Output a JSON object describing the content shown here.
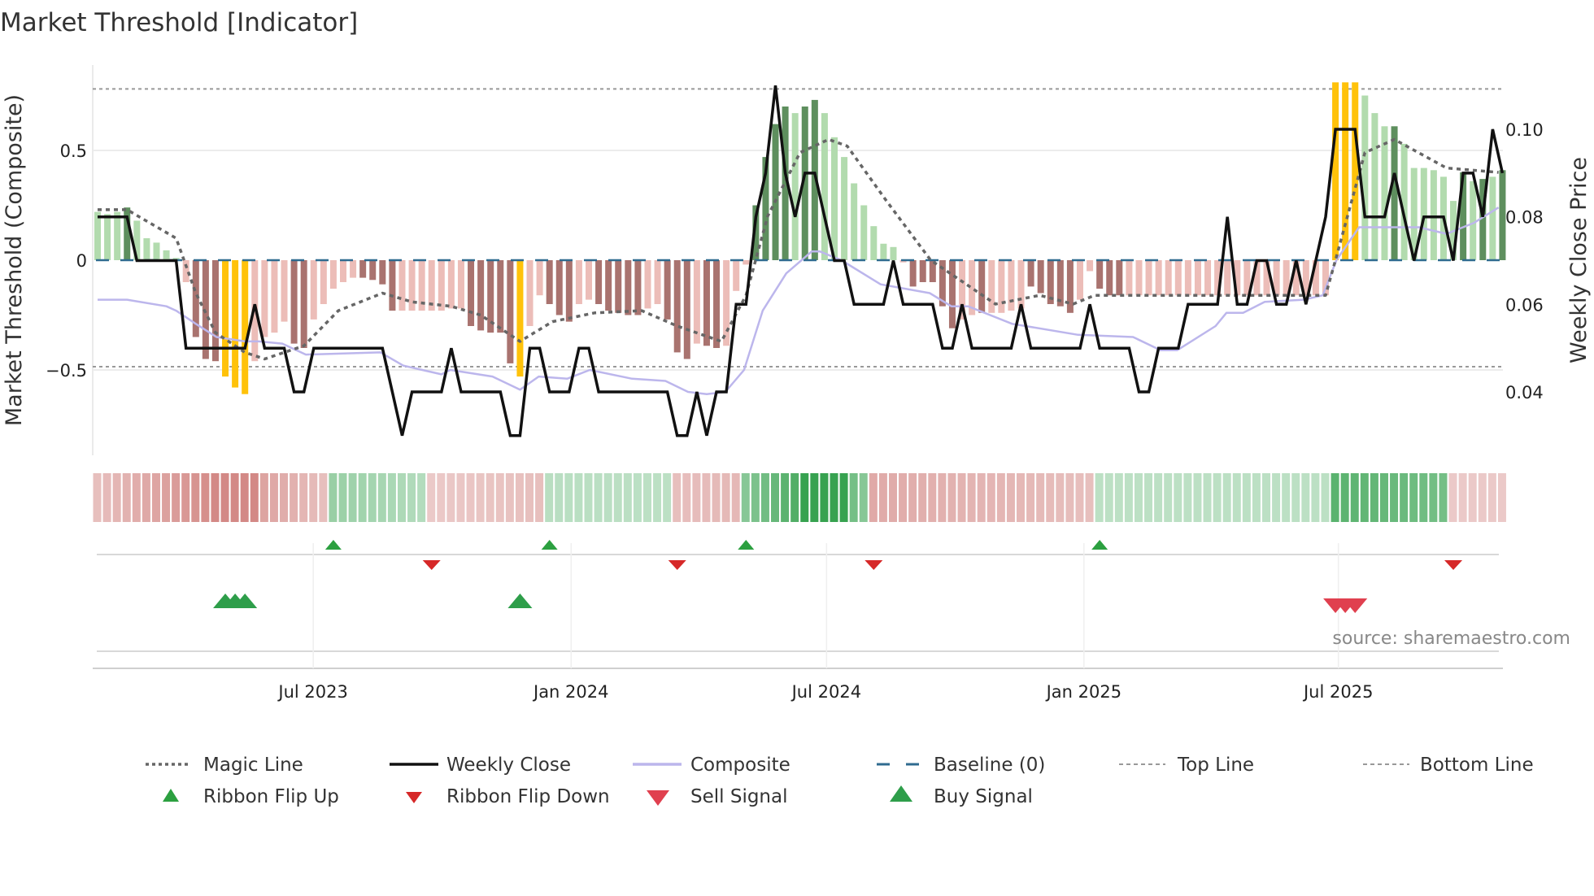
{
  "title": "Market Threshold [Indicator]",
  "source": "source: sharemaestro.com",
  "colors": {
    "bar_dark_green": "#5e8f5e",
    "bar_light_green": "#b2dbae",
    "bar_dark_red": "#a9736f",
    "bar_light_red": "#ecbdb8",
    "bar_yellow": "#ffc20a",
    "ribbon_green": "#2e9e48",
    "ribbon_red": "#c4605c",
    "magic": "#666666",
    "close": "#111111",
    "composite": "#bcb6ec",
    "baseline": "#2f6b8f",
    "guide": "#999999",
    "flip_up": "#2ca040",
    "flip_down": "#d62828",
    "buy": "#2e9e4a",
    "sell": "#e0404f"
  },
  "chart_data": {
    "type": "bar+line",
    "title": "Market Threshold [Indicator]",
    "ylabel": "Market Threshold (Composite)",
    "y2label": "Weekly Close Price",
    "ylim": [
      -0.9,
      0.9
    ],
    "y2lim": [
      0.025,
      0.115
    ],
    "yticks": [
      {
        "v": 0.5,
        "label": "0.5"
      },
      {
        "v": 0,
        "label": "0"
      },
      {
        "v": -0.5,
        "label": "−0.5"
      }
    ],
    "y2ticks": [
      {
        "v": 0.1,
        "label": "0.10"
      },
      {
        "v": 0.08,
        "label": "0.08"
      },
      {
        "v": 0.06,
        "label": "0.06"
      },
      {
        "v": 0.04,
        "label": "0.04"
      }
    ],
    "xticks": [
      {
        "week": 21.95,
        "label": "Jul 2023"
      },
      {
        "week": 48.2,
        "label": "Jan 2024"
      },
      {
        "week": 74.2,
        "label": "Jul 2024"
      },
      {
        "week": 100.4,
        "label": "Jan 2025"
      },
      {
        "week": 126.3,
        "label": "Jul 2025"
      }
    ],
    "top_line": 0.78,
    "bottom_line": -0.485,
    "baseline": 0,
    "bars": [
      [
        0.22,
        "g"
      ],
      [
        0.21,
        "g"
      ],
      [
        0.22,
        "g"
      ],
      [
        0.24,
        "G"
      ],
      [
        0.18,
        "g"
      ],
      [
        0.1,
        "g"
      ],
      [
        0.08,
        "g"
      ],
      [
        0.045,
        "g"
      ],
      [
        0.01,
        "g"
      ],
      [
        -0.1,
        "r"
      ],
      [
        -0.35,
        "R"
      ],
      [
        -0.45,
        "R"
      ],
      [
        -0.46,
        "R"
      ],
      [
        -0.53,
        "Y"
      ],
      [
        -0.58,
        "Y"
      ],
      [
        -0.61,
        "Y"
      ],
      [
        -0.46,
        "r"
      ],
      [
        -0.35,
        "r"
      ],
      [
        -0.33,
        "r"
      ],
      [
        -0.28,
        "r"
      ],
      [
        -0.38,
        "R"
      ],
      [
        -0.4,
        "R"
      ],
      [
        -0.27,
        "r"
      ],
      [
        -0.2,
        "r"
      ],
      [
        -0.13,
        "r"
      ],
      [
        -0.1,
        "r"
      ],
      [
        -0.08,
        "r"
      ],
      [
        -0.08,
        "R"
      ],
      [
        -0.09,
        "R"
      ],
      [
        -0.11,
        "R"
      ],
      [
        -0.23,
        "R"
      ],
      [
        -0.23,
        "r"
      ],
      [
        -0.23,
        "r"
      ],
      [
        -0.23,
        "r"
      ],
      [
        -0.23,
        "r"
      ],
      [
        -0.23,
        "r"
      ],
      [
        -0.22,
        "r"
      ],
      [
        -0.22,
        "r"
      ],
      [
        -0.3,
        "R"
      ],
      [
        -0.32,
        "R"
      ],
      [
        -0.33,
        "R"
      ],
      [
        -0.33,
        "R"
      ],
      [
        -0.47,
        "R"
      ],
      [
        -0.53,
        "Y"
      ],
      [
        -0.3,
        "r"
      ],
      [
        -0.16,
        "r"
      ],
      [
        -0.2,
        "R"
      ],
      [
        -0.25,
        "R"
      ],
      [
        -0.28,
        "R"
      ],
      [
        -0.2,
        "r"
      ],
      [
        -0.18,
        "r"
      ],
      [
        -0.2,
        "R"
      ],
      [
        -0.23,
        "R"
      ],
      [
        -0.24,
        "R"
      ],
      [
        -0.25,
        "R"
      ],
      [
        -0.25,
        "R"
      ],
      [
        -0.22,
        "r"
      ],
      [
        -0.2,
        "r"
      ],
      [
        -0.27,
        "R"
      ],
      [
        -0.42,
        "R"
      ],
      [
        -0.45,
        "R"
      ],
      [
        -0.38,
        "r"
      ],
      [
        -0.39,
        "R"
      ],
      [
        -0.4,
        "R"
      ],
      [
        -0.39,
        "r"
      ],
      [
        -0.14,
        "r"
      ],
      [
        -0.02,
        "r"
      ],
      [
        0.25,
        "G"
      ],
      [
        0.47,
        "G"
      ],
      [
        0.62,
        "G"
      ],
      [
        0.7,
        "G"
      ],
      [
        0.67,
        "g"
      ],
      [
        0.7,
        "G"
      ],
      [
        0.73,
        "G"
      ],
      [
        0.67,
        "g"
      ],
      [
        0.56,
        "g"
      ],
      [
        0.47,
        "g"
      ],
      [
        0.35,
        "g"
      ],
      [
        0.25,
        "g"
      ],
      [
        0.155,
        "g"
      ],
      [
        0.075,
        "g"
      ],
      [
        0.06,
        "g"
      ],
      [
        -0.01,
        "r"
      ],
      [
        -0.12,
        "R"
      ],
      [
        -0.1,
        "R"
      ],
      [
        -0.1,
        "R"
      ],
      [
        -0.21,
        "R"
      ],
      [
        -0.31,
        "R"
      ],
      [
        -0.27,
        "r"
      ],
      [
        -0.25,
        "r"
      ],
      [
        -0.24,
        "R"
      ],
      [
        -0.24,
        "r"
      ],
      [
        -0.24,
        "r"
      ],
      [
        -0.23,
        "r"
      ],
      [
        -0.22,
        "r"
      ],
      [
        -0.12,
        "R"
      ],
      [
        -0.15,
        "R"
      ],
      [
        -0.2,
        "R"
      ],
      [
        -0.21,
        "R"
      ],
      [
        -0.24,
        "R"
      ],
      [
        -0.18,
        "r"
      ],
      [
        -0.05,
        "r"
      ],
      [
        -0.13,
        "R"
      ],
      [
        -0.16,
        "R"
      ],
      [
        -0.16,
        "R"
      ],
      [
        -0.16,
        "r"
      ],
      [
        -0.16,
        "r"
      ],
      [
        -0.16,
        "r"
      ],
      [
        -0.16,
        "r"
      ],
      [
        -0.16,
        "r"
      ],
      [
        -0.16,
        "r"
      ],
      [
        -0.16,
        "r"
      ],
      [
        -0.16,
        "r"
      ],
      [
        -0.16,
        "r"
      ],
      [
        -0.16,
        "r"
      ],
      [
        -0.16,
        "r"
      ],
      [
        -0.16,
        "r"
      ],
      [
        -0.16,
        "r"
      ],
      [
        -0.16,
        "r"
      ],
      [
        -0.16,
        "r"
      ],
      [
        -0.16,
        "r"
      ],
      [
        -0.16,
        "r"
      ],
      [
        -0.16,
        "r"
      ],
      [
        -0.16,
        "r"
      ],
      [
        -0.16,
        "r"
      ],
      [
        -0.16,
        "r"
      ],
      [
        0.81,
        "Y"
      ],
      [
        0.81,
        "Y"
      ],
      [
        0.81,
        "Y"
      ],
      [
        0.75,
        "g"
      ],
      [
        0.67,
        "g"
      ],
      [
        0.61,
        "g"
      ],
      [
        0.61,
        "G"
      ],
      [
        0.53,
        "g"
      ],
      [
        0.42,
        "g"
      ],
      [
        0.42,
        "g"
      ],
      [
        0.41,
        "g"
      ],
      [
        0.38,
        "g"
      ],
      [
        0.27,
        "g"
      ],
      [
        0.4,
        "G"
      ],
      [
        0.36,
        "g"
      ],
      [
        0.37,
        "G"
      ],
      [
        0.38,
        "g"
      ],
      [
        0.41,
        "G"
      ]
    ],
    "weekly_close": [
      0.08,
      0.08,
      0.08,
      0.08,
      0.07,
      0.07,
      0.07,
      0.07,
      0.07,
      0.05,
      0.05,
      0.05,
      0.05,
      0.05,
      0.05,
      0.05,
      0.06,
      0.05,
      0.05,
      0.05,
      0.04,
      0.04,
      0.05,
      0.05,
      0.05,
      0.05,
      0.05,
      0.05,
      0.05,
      0.05,
      0.04,
      0.03,
      0.04,
      0.04,
      0.04,
      0.04,
      0.05,
      0.04,
      0.04,
      0.04,
      0.04,
      0.04,
      0.03,
      0.03,
      0.05,
      0.05,
      0.04,
      0.04,
      0.04,
      0.05,
      0.05,
      0.04,
      0.04,
      0.04,
      0.04,
      0.04,
      0.04,
      0.04,
      0.04,
      0.03,
      0.03,
      0.04,
      0.03,
      0.04,
      0.04,
      0.06,
      0.06,
      0.08,
      0.09,
      0.11,
      0.09,
      0.08,
      0.09,
      0.09,
      0.08,
      0.07,
      0.07,
      0.06,
      0.06,
      0.06,
      0.06,
      0.07,
      0.06,
      0.06,
      0.06,
      0.06,
      0.05,
      0.05,
      0.06,
      0.05,
      0.05,
      0.05,
      0.05,
      0.05,
      0.06,
      0.05,
      0.05,
      0.05,
      0.05,
      0.05,
      0.05,
      0.06,
      0.05,
      0.05,
      0.05,
      0.05,
      0.04,
      0.04,
      0.05,
      0.05,
      0.05,
      0.06,
      0.06,
      0.06,
      0.06,
      0.08,
      0.06,
      0.06,
      0.07,
      0.07,
      0.06,
      0.06,
      0.07,
      0.06,
      0.07,
      0.08,
      0.1,
      0.1,
      0.1,
      0.08,
      0.08,
      0.08,
      0.09,
      0.08,
      0.07,
      0.08,
      0.08,
      0.08,
      0.07,
      0.09,
      0.09,
      0.08,
      0.1,
      0.09
    ],
    "magic_line": [
      [
        0,
        0.23
      ],
      [
        3,
        0.23
      ],
      [
        8,
        0.1
      ],
      [
        10,
        -0.15
      ],
      [
        12,
        -0.33
      ],
      [
        15,
        -0.42
      ],
      [
        17,
        -0.45
      ],
      [
        21,
        -0.39
      ],
      [
        24.5,
        -0.23
      ],
      [
        29,
        -0.15
      ],
      [
        32,
        -0.19
      ],
      [
        36,
        -0.21
      ],
      [
        39,
        -0.25
      ],
      [
        43,
        -0.37
      ],
      [
        46.3,
        -0.28
      ],
      [
        50.6,
        -0.24
      ],
      [
        55.4,
        -0.23
      ],
      [
        59,
        -0.3
      ],
      [
        63.5,
        -0.37
      ],
      [
        66,
        -0.16
      ],
      [
        68.2,
        0.2
      ],
      [
        71.5,
        0.49
      ],
      [
        74.4,
        0.55
      ],
      [
        76.3,
        0.52
      ],
      [
        80.3,
        0.27
      ],
      [
        84.8,
        0
      ],
      [
        91.4,
        -0.2
      ],
      [
        95.9,
        -0.16
      ],
      [
        99.3,
        -0.2
      ],
      [
        101.5,
        -0.16
      ],
      [
        125,
        -0.16
      ],
      [
        126,
        0
      ],
      [
        129,
        0.49
      ],
      [
        132,
        0.55
      ],
      [
        137.3,
        0.42
      ],
      [
        142.6,
        0.4
      ]
    ],
    "composite": [
      [
        0,
        -0.18
      ],
      [
        3,
        -0.18
      ],
      [
        7,
        -0.21
      ],
      [
        8,
        -0.23
      ],
      [
        10,
        -0.29
      ],
      [
        12.1,
        -0.35
      ],
      [
        15,
        -0.37
      ],
      [
        16.4,
        -0.37
      ],
      [
        18.8,
        -0.38
      ],
      [
        21.2,
        -0.43
      ],
      [
        28.8,
        -0.42
      ],
      [
        31.1,
        -0.48
      ],
      [
        35,
        -0.52
      ],
      [
        35.9,
        -0.5
      ],
      [
        40.2,
        -0.53
      ],
      [
        43,
        -0.59
      ],
      [
        44.9,
        -0.53
      ],
      [
        47.8,
        -0.54
      ],
      [
        50.1,
        -0.5
      ],
      [
        54.4,
        -0.54
      ],
      [
        57.8,
        -0.55
      ],
      [
        60.1,
        -0.6
      ],
      [
        62,
        -0.61
      ],
      [
        63.9,
        -0.6
      ],
      [
        65.8,
        -0.5
      ],
      [
        67.7,
        -0.23
      ],
      [
        70.1,
        -0.06
      ],
      [
        72.7,
        0.04
      ],
      [
        73.5,
        0.04
      ],
      [
        75.7,
        0
      ],
      [
        79.7,
        -0.11
      ],
      [
        84.7,
        -0.15
      ],
      [
        86.9,
        -0.21
      ],
      [
        88.6,
        -0.21
      ],
      [
        93.1,
        -0.29
      ],
      [
        99.8,
        -0.34
      ],
      [
        105.4,
        -0.35
      ],
      [
        108.2,
        -0.41
      ],
      [
        109.9,
        -0.41
      ],
      [
        113.8,
        -0.3
      ],
      [
        114.9,
        -0.24
      ],
      [
        116.6,
        -0.24
      ],
      [
        118.8,
        -0.19
      ],
      [
        122.8,
        -0.18
      ],
      [
        124.7,
        -0.16
      ],
      [
        126.1,
        0
      ],
      [
        128.4,
        0.15
      ],
      [
        131.7,
        0.15
      ],
      [
        134.5,
        0.15
      ],
      [
        137.3,
        0.12
      ],
      [
        140.1,
        0.17
      ],
      [
        142.6,
        0.24
      ]
    ],
    "ribbon_segments": [
      [
        0,
        11,
        -0.3,
        -0.65
      ],
      [
        12,
        16,
        -0.7,
        -0.7
      ],
      [
        17,
        23,
        -0.5,
        -0.3
      ],
      [
        24,
        33,
        0.4,
        0.25
      ],
      [
        34,
        45,
        -0.22,
        -0.3
      ],
      [
        46,
        58,
        0.22,
        0.2
      ],
      [
        59,
        65,
        -0.3,
        -0.35
      ],
      [
        66,
        71,
        0.5,
        0.8
      ],
      [
        72,
        76,
        0.95,
        0.95
      ],
      [
        77,
        78,
        0.6,
        0.5
      ],
      [
        79,
        101,
        -0.45,
        -0.3
      ],
      [
        102,
        125,
        0.2,
        0.2
      ],
      [
        126,
        137,
        0.75,
        0.6
      ],
      [
        138,
        143,
        -0.22,
        -0.22
      ]
    ],
    "ribbon_flip_up": [
      24,
      46,
      66,
      102
    ],
    "ribbon_flip_down": [
      34,
      59,
      79,
      138
    ],
    "buy_signals": [
      13,
      14,
      15,
      43
    ],
    "sell_signals": [
      126,
      127,
      128
    ],
    "legend": {
      "magic": "Magic Line",
      "close": "Weekly Close",
      "composite": "Composite",
      "baseline": "Baseline (0)",
      "top": "Top Line",
      "bottom": "Bottom Line",
      "flip_up": "Ribbon Flip Up",
      "flip_down": "Ribbon Flip Down",
      "sell": "Sell Signal",
      "buy": "Buy Signal"
    },
    "legend_placement": "bottom"
  }
}
